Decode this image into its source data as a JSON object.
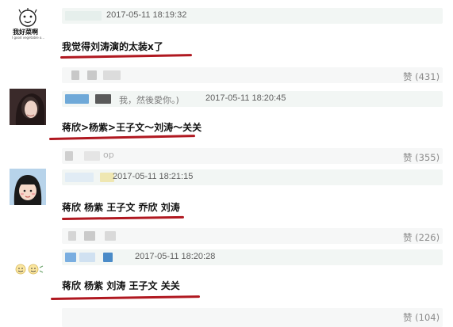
{
  "comments": [
    {
      "time": "2017-05-11 18:19:32",
      "name_fragment": "",
      "avatar_caption": "我好菜啊",
      "avatar_caption_sub": "I good vegetable o...",
      "text": "我觉得刘涛演的太装x了",
      "likes": "赞 (431)"
    },
    {
      "time": "2017-05-11 18:20:45",
      "name_fragment": "我，然後愛你。)",
      "text": "蒋欣>杨紫>王子文～刘涛～关关",
      "likes": "赞 (355)",
      "blur_label": "op"
    },
    {
      "time": "2017-05-11 18:21:15",
      "name_fragment": "",
      "text": "蒋欣 杨紫 王子文 乔欣 刘涛",
      "likes": "赞 (226)"
    },
    {
      "time": "2017-05-11 18:20:28",
      "name_fragment": "",
      "text": "蒋欣 杨紫 刘涛 王子文 关关",
      "likes": "赞 (104)"
    }
  ],
  "colors": {
    "underline": "#b01820",
    "meta_bar": "#f2f6f4",
    "like_text": "#8a8a8a"
  }
}
